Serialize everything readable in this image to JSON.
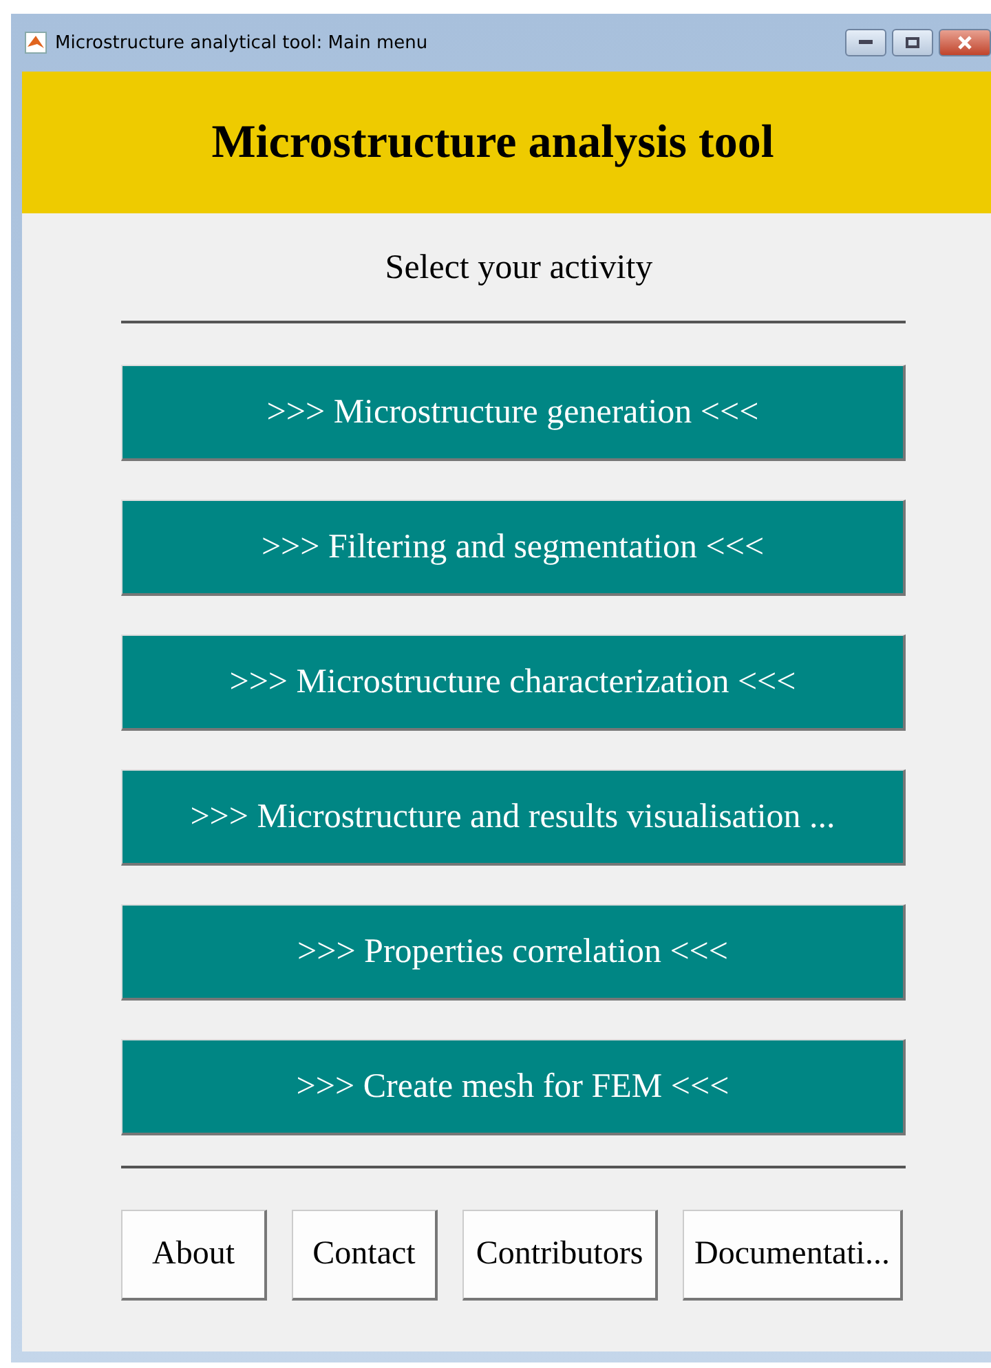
{
  "window": {
    "title": "Microstructure analytical tool: Main menu"
  },
  "header": {
    "title": "Microstructure analysis tool"
  },
  "prompt": "Select your activity",
  "activities": [
    {
      "label": ">>> Microstructure generation <<<"
    },
    {
      "label": ">>> Filtering and segmentation <<<"
    },
    {
      "label": ">>> Microstructure characterization <<<"
    },
    {
      "label": ">>> Microstructure and results visualisation ..."
    },
    {
      "label": ">>> Properties correlation <<<"
    },
    {
      "label": ">>> Create mesh for FEM <<<"
    }
  ],
  "footer_buttons": [
    {
      "label": "About"
    },
    {
      "label": "Contact"
    },
    {
      "label": "Contributors"
    },
    {
      "label": "Documentati..."
    }
  ]
}
